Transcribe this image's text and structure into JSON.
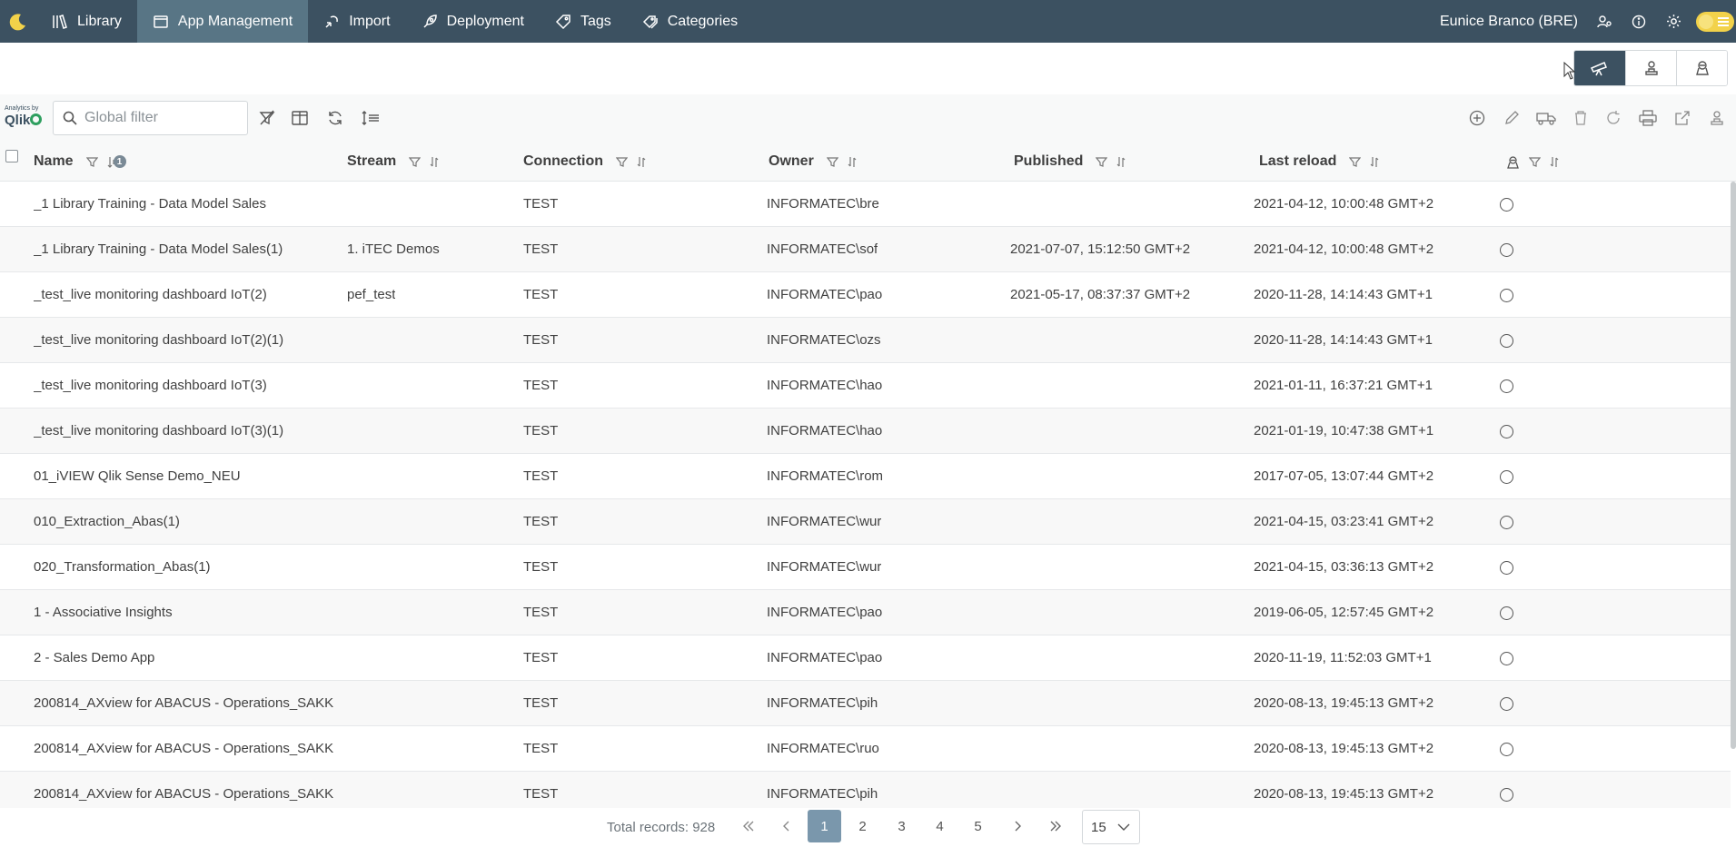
{
  "nav": {
    "items": [
      {
        "label": "Library",
        "icon": "library-icon"
      },
      {
        "label": "App Management",
        "icon": "app-management-icon",
        "active": true
      },
      {
        "label": "Import",
        "icon": "import-icon"
      },
      {
        "label": "Deployment",
        "icon": "rocket-icon"
      },
      {
        "label": "Tags",
        "icon": "tag-icon"
      },
      {
        "label": "Categories",
        "icon": "categories-icon"
      }
    ],
    "user": "Eunice Branco (BRE)"
  },
  "toolbar": {
    "logo_small": "Analytics by",
    "logo_big": "Qlik",
    "filter_placeholder": "Global filter"
  },
  "columns": {
    "name": "Name",
    "stream": "Stream",
    "connection": "Connection",
    "owner": "Owner",
    "published": "Published",
    "last_reload": "Last reload",
    "sort_badge": "1"
  },
  "rows": [
    {
      "name": "_1 Library Training - Data Model Sales",
      "stream": "",
      "connection": "TEST",
      "owner": "INFORMATEC\\bre",
      "published": "",
      "last_reload": "2021-04-12, 10:00:48 GMT+2"
    },
    {
      "name": "_1 Library Training - Data Model Sales(1)",
      "stream": "1. iTEC Demos",
      "connection": "TEST",
      "owner": "INFORMATEC\\sof",
      "published": "2021-07-07, 15:12:50 GMT+2",
      "last_reload": "2021-04-12, 10:00:48 GMT+2"
    },
    {
      "name": "_test_live monitoring dashboard IoT(2)",
      "stream": "pef_test",
      "connection": "TEST",
      "owner": "INFORMATEC\\pao",
      "published": "2021-05-17, 08:37:37 GMT+2",
      "last_reload": "2020-11-28, 14:14:43 GMT+1"
    },
    {
      "name": "_test_live monitoring dashboard IoT(2)(1)",
      "stream": "",
      "connection": "TEST",
      "owner": "INFORMATEC\\ozs",
      "published": "",
      "last_reload": "2020-11-28, 14:14:43 GMT+1"
    },
    {
      "name": "_test_live monitoring dashboard IoT(3)",
      "stream": "",
      "connection": "TEST",
      "owner": "INFORMATEC\\hao",
      "published": "",
      "last_reload": "2021-01-11, 16:37:21 GMT+1"
    },
    {
      "name": "_test_live monitoring dashboard IoT(3)(1)",
      "stream": "",
      "connection": "TEST",
      "owner": "INFORMATEC\\hao",
      "published": "",
      "last_reload": "2021-01-19, 10:47:38 GMT+1"
    },
    {
      "name": "01_iVIEW Qlik Sense Demo_NEU",
      "stream": "",
      "connection": "TEST",
      "owner": "INFORMATEC\\rom",
      "published": "",
      "last_reload": "2017-07-05, 13:07:44 GMT+2"
    },
    {
      "name": "010_Extraction_Abas(1)",
      "stream": "",
      "connection": "TEST",
      "owner": "INFORMATEC\\wur",
      "published": "",
      "last_reload": "2021-04-15, 03:23:41 GMT+2"
    },
    {
      "name": "020_Transformation_Abas(1)",
      "stream": "",
      "connection": "TEST",
      "owner": "INFORMATEC\\wur",
      "published": "",
      "last_reload": "2021-04-15, 03:36:13 GMT+2"
    },
    {
      "name": "1 - Associative Insights",
      "stream": "",
      "connection": "TEST",
      "owner": "INFORMATEC\\pao",
      "published": "",
      "last_reload": "2019-06-05, 12:57:45 GMT+2"
    },
    {
      "name": "2 - Sales Demo App",
      "stream": "",
      "connection": "TEST",
      "owner": "INFORMATEC\\pao",
      "published": "",
      "last_reload": "2020-11-19, 11:52:03 GMT+1"
    },
    {
      "name": "200814_AXview for ABACUS - Operations_SAKK",
      "stream": "",
      "connection": "TEST",
      "owner": "INFORMATEC\\pih",
      "published": "",
      "last_reload": "2020-08-13, 19:45:13 GMT+2"
    },
    {
      "name": "200814_AXview for ABACUS - Operations_SAKK",
      "stream": "",
      "connection": "TEST",
      "owner": "INFORMATEC\\ruo",
      "published": "",
      "last_reload": "2020-08-13, 19:45:13 GMT+2"
    },
    {
      "name": "200814_AXview for ABACUS - Operations_SAKK",
      "stream": "",
      "connection": "TEST",
      "owner": "INFORMATEC\\pih",
      "published": "",
      "last_reload": "2020-08-13, 19:45:13 GMT+2"
    }
  ],
  "pagination": {
    "total": "Total records: 928",
    "pages": [
      "1",
      "2",
      "3",
      "4",
      "5"
    ],
    "current": "1",
    "page_size": "15"
  },
  "colors": {
    "topbar": "#3c5161",
    "active_nav": "#587585",
    "active_page": "#7a97ac",
    "toggle": "#f2d24a"
  }
}
